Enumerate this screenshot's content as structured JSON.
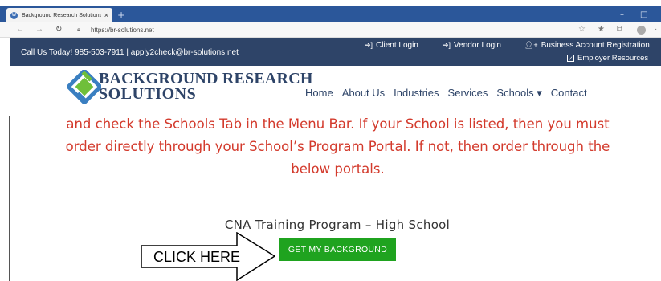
{
  "browser": {
    "tab_title": "Background Research Solutions",
    "tab_close": "×",
    "new_tab": "+",
    "url": "https://br-solutions.net",
    "minimize": "–",
    "maximize": "□"
  },
  "topbar": {
    "contact": "Call Us Today! 985-503-7911 | apply2check@br-solutions.net",
    "client_login": "Client Login",
    "vendor_login": "Vendor Login",
    "business_registration": "Business Account Registration",
    "employer_resources": "Employer Resources"
  },
  "header": {
    "logo_line1": "BACKGROUND RESEARCH",
    "logo_line2": "SOLUTIONS",
    "nav": [
      {
        "label": "Home"
      },
      {
        "label": "About Us"
      },
      {
        "label": "Industries"
      },
      {
        "label": "Services"
      },
      {
        "label": "Schools ▾"
      },
      {
        "label": "Contact"
      }
    ]
  },
  "main": {
    "notice_line1": "and check the Schools Tab in the Menu Bar. If your School is listed, then you must",
    "notice_line2": "order directly through your School’s Program Portal. If not, then order through the",
    "notice_line3": "below portals.",
    "program_title": "CNA Training Program – High School",
    "cta_label": "GET MY BACKGROUND",
    "callout_label": "CLICK HERE"
  },
  "colors": {
    "titlebar": "#2b579a",
    "topbar": "#2e4468",
    "notice_red": "#d33a2c",
    "cta_green": "#1fa31f"
  }
}
